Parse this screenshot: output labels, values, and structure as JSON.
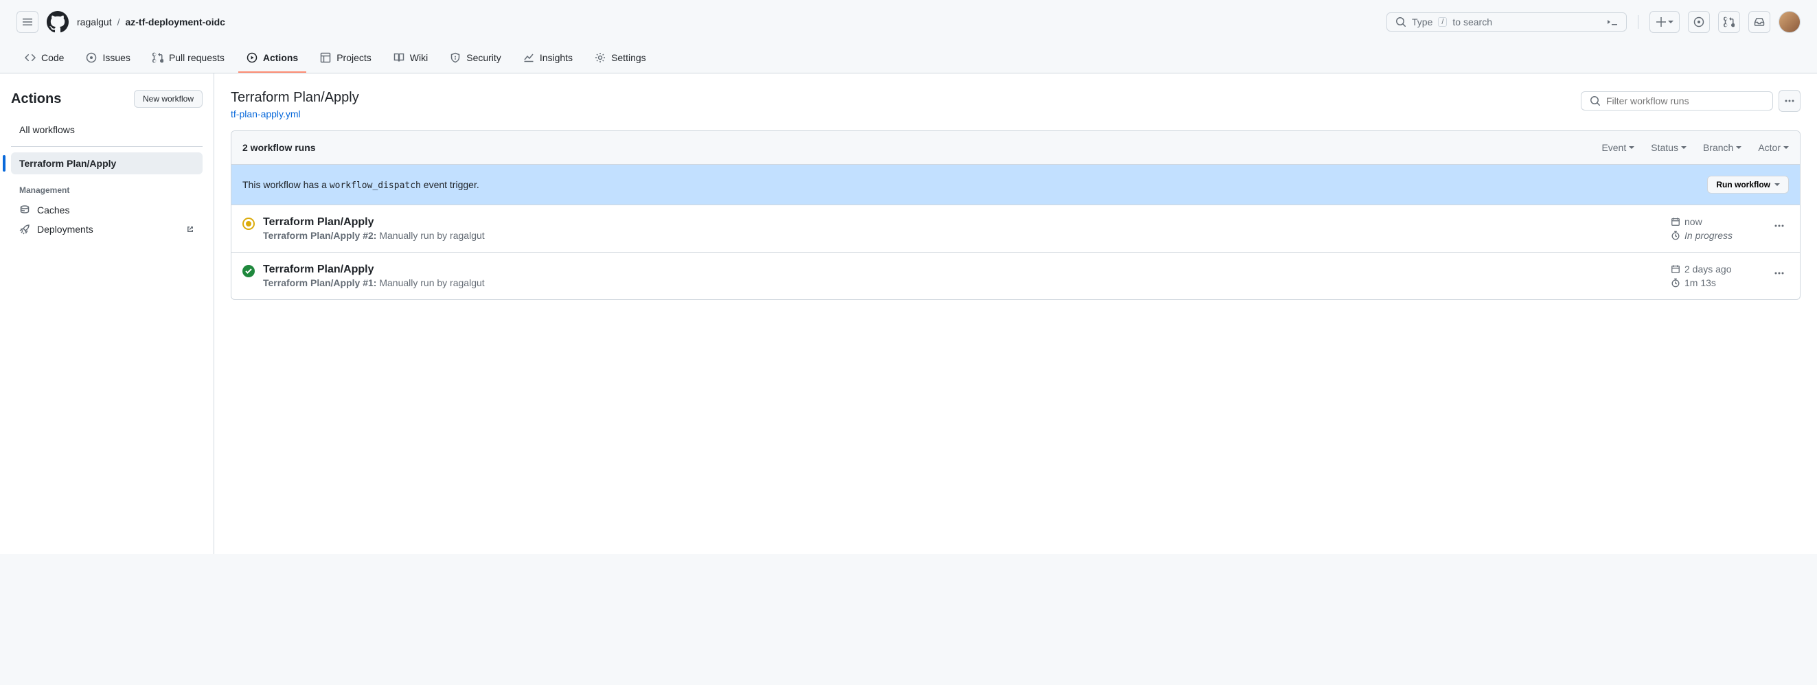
{
  "breadcrumb": {
    "owner": "ragalgut",
    "repo": "az-tf-deployment-oidc"
  },
  "search": {
    "placeholder_prefix": "Type",
    "key": "/",
    "placeholder_suffix": "to search"
  },
  "nav": {
    "code": "Code",
    "issues": "Issues",
    "pulls": "Pull requests",
    "actions": "Actions",
    "projects": "Projects",
    "wiki": "Wiki",
    "security": "Security",
    "insights": "Insights",
    "settings": "Settings"
  },
  "sidebar": {
    "title": "Actions",
    "new_workflow": "New workflow",
    "all_workflows": "All workflows",
    "workflow_name": "Terraform Plan/Apply",
    "management": "Management",
    "caches": "Caches",
    "deployments": "Deployments"
  },
  "page": {
    "title": "Terraform Plan/Apply",
    "file": "tf-plan-apply.yml",
    "filter_placeholder": "Filter workflow runs"
  },
  "runs_header": {
    "count": "2 workflow runs",
    "event": "Event",
    "status": "Status",
    "branch": "Branch",
    "actor": "Actor"
  },
  "dispatch": {
    "text_prefix": "This workflow has a ",
    "code": "workflow_dispatch",
    "text_suffix": " event trigger.",
    "button": "Run workflow"
  },
  "runs": [
    {
      "status": "in_progress",
      "title": "Terraform Plan/Apply",
      "sub_bold": "Terraform Plan/Apply #2:",
      "sub_rest": " Manually run by ragalgut",
      "time": "now",
      "duration": "In progress",
      "duration_italic": true
    },
    {
      "status": "success",
      "title": "Terraform Plan/Apply",
      "sub_bold": "Terraform Plan/Apply #1:",
      "sub_rest": " Manually run by ragalgut",
      "time": "2 days ago",
      "duration": "1m 13s",
      "duration_italic": false
    }
  ]
}
